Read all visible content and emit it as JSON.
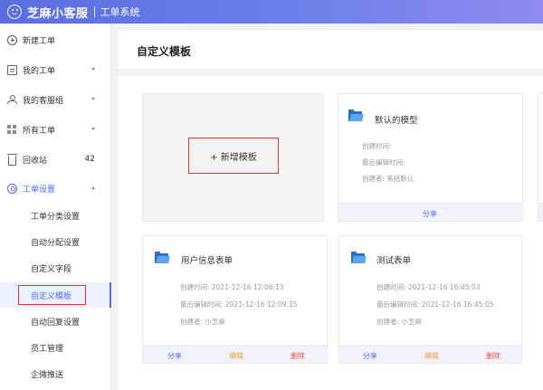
{
  "app": {
    "brand": "芝麻小客服",
    "subtitle": "工单系统"
  },
  "sidebar": {
    "items": [
      {
        "label": "新建工单",
        "icon": "plus-circle-icon"
      },
      {
        "label": "我的工单",
        "icon": "document-icon"
      },
      {
        "label": "我的客服组",
        "icon": "group-icon"
      },
      {
        "label": "所有工单",
        "icon": "grid-icon"
      },
      {
        "label": "回收站",
        "icon": "trash-icon",
        "count": "42"
      },
      {
        "label": "工单设置",
        "icon": "gear-icon"
      }
    ],
    "subitems": [
      {
        "label": "工单分类设置"
      },
      {
        "label": "自动分配设置"
      },
      {
        "label": "自定义字段"
      },
      {
        "label": "自定义模板",
        "active": true
      },
      {
        "label": "自动回复设置"
      },
      {
        "label": "员工管理"
      },
      {
        "label": "企微推送"
      }
    ]
  },
  "page": {
    "title": "自定义模板"
  },
  "add_card": {
    "label": "+ 新增模板"
  },
  "cards": [
    {
      "title": "默认的模型",
      "created_label": "创建时间:",
      "modified_label": "最后编辑时间:",
      "creator_label": "创建者: 系统默认",
      "actions": {
        "share": "分享"
      }
    },
    {
      "title": "用户信息表单",
      "created_label": "创建时间: 2021-12-16 12:06:13",
      "modified_label": "最后编辑时间: 2021-12-16 12:09:15",
      "creator_label": "创建者: 小芝麻",
      "actions": {
        "share": "分享",
        "edit": "编辑",
        "delete": "删除"
      }
    },
    {
      "title": "测试表单",
      "created_label": "创建时间: 2021-12-16 16:45:03",
      "modified_label": "最后编辑时间: 2021-12-16 16:45:05",
      "creator_label": "创建者: 小芝麻",
      "actions": {
        "share": "分享",
        "edit": "编辑",
        "delete": "删除"
      }
    }
  ],
  "colors": {
    "accent": "#4a6cf7",
    "highlight_box": "#dd3333",
    "edit": "#e8a24a",
    "delete": "#e05050"
  }
}
